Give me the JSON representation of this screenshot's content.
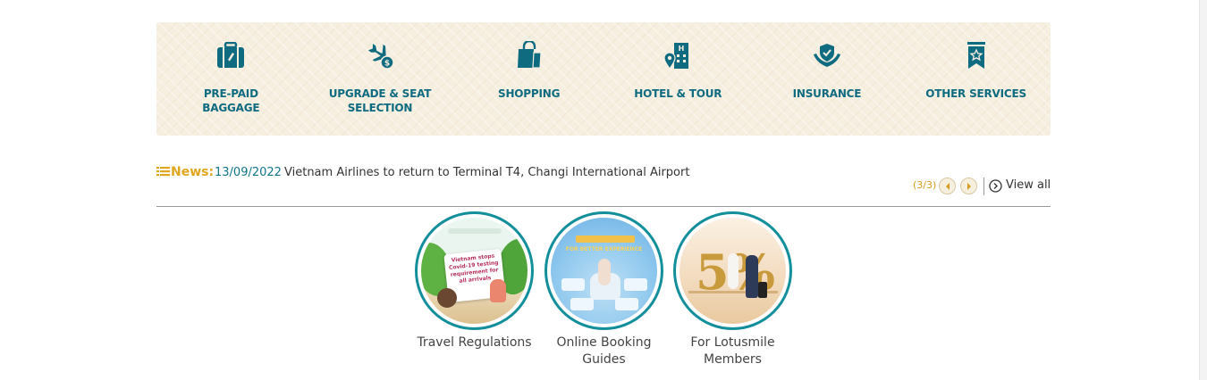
{
  "services": [
    {
      "label": "PRE-PAID BAGGAGE",
      "icon": "baggage-icon"
    },
    {
      "label": "UPGRADE & SEAT SELECTION",
      "icon": "upgrade-plane-icon"
    },
    {
      "label": "SHOPPING",
      "icon": "shopping-bag-icon"
    },
    {
      "label": "HOTEL & TOUR",
      "icon": "hotel-icon"
    },
    {
      "label": "INSURANCE",
      "icon": "insurance-shield-icon"
    },
    {
      "label": "OTHER SERVICES",
      "icon": "star-bookmark-icon"
    }
  ],
  "news": {
    "title": "News:",
    "date": "13/09/2022",
    "headline": "Vietnam Airlines to return to Terminal T4, Changi International Airport",
    "counter": "(3/3)",
    "view_all": "View all"
  },
  "promos": [
    {
      "caption": "Travel Regulations",
      "art_text": "Vietnam stops Covid-19 testing requirement for all arrivals"
    },
    {
      "caption": "Online Booking Guides",
      "art_text": "FOR BETTER EXPERIENCE"
    },
    {
      "caption": "For Lotusmile Members",
      "art_text": "5%"
    }
  ],
  "colors": {
    "brand_teal": "#0e6b80",
    "accent_gold": "#e0a61f",
    "ring_teal": "#138f9c",
    "panel_bg": "#f6eedf"
  }
}
